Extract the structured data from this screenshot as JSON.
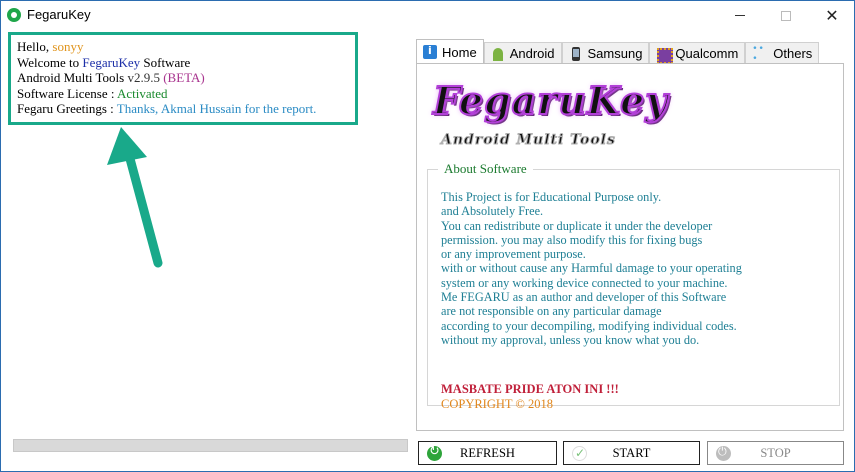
{
  "window": {
    "title": "FegaruKey",
    "controls": {
      "minimize": "minimize",
      "maximize": "maximize",
      "close": "✕"
    }
  },
  "greeting": {
    "hello_prefix": "Hello, ",
    "user": "sonyy",
    "welcome_prefix": "Welcome to ",
    "app_name": "FegaruKey",
    "welcome_suffix": " Software",
    "product_prefix": "Android Multi Tools ",
    "version": "v2.9.5",
    "beta": "(BETA)",
    "license_prefix": "Software License : ",
    "license_status": "Activated",
    "greetings_prefix": "Fegaru Greetings : ",
    "greetings_text": "Thanks, Akmal Hussain for the report."
  },
  "progress": {
    "value": 0
  },
  "tabs": [
    {
      "label": "Home",
      "icon": "info-icon",
      "active": true
    },
    {
      "label": "Android",
      "icon": "android-icon",
      "active": false
    },
    {
      "label": "Samsung",
      "icon": "phone-icon",
      "active": false
    },
    {
      "label": "Qualcomm",
      "icon": "chip-icon",
      "active": false
    },
    {
      "label": "Others",
      "icon": "dots-icon",
      "active": false
    }
  ],
  "home": {
    "logo_title": "FegaruKey",
    "logo_subtitle": "Android Multi Tools",
    "about_title": "About Software",
    "about_lines": [
      "This Project is for Educational Purpose only.",
      "and Absolutely Free.",
      "You can redistribute or duplicate it under the developer",
      "permission. you may also modify this for fixing bugs",
      "or any improvement purpose.",
      "with or without cause any Harmful damage to your operating",
      "system or any working device connected to your machine.",
      "Me FEGARU as an author and developer of this Software",
      "are not responsible on any particular damage",
      "according to your decompiling, modifying individual codes.",
      "without my approval, unless you know what you do."
    ],
    "pride": "MASBATE PRIDE ATON INI !!!",
    "copyright": "COPYRIGHT © 2018"
  },
  "buttons": {
    "refresh": "REFRESH",
    "start": "START",
    "stop": "STOP"
  },
  "colors": {
    "accent_teal": "#19a98a",
    "about_text": "#1e7f94",
    "pride_red": "#c0203a",
    "copyright_orange": "#e0861c"
  }
}
